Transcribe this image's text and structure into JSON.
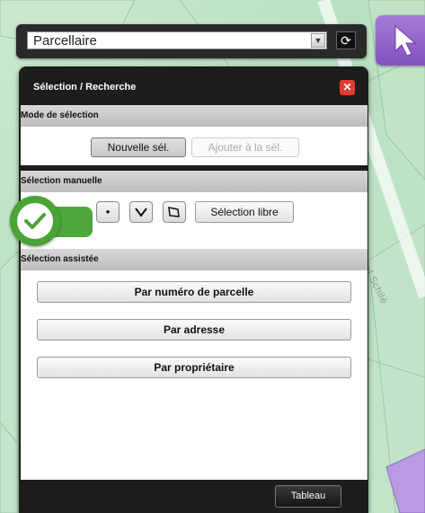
{
  "layer_select": {
    "value": "Parcellaire",
    "arrow_glyph": "▼",
    "refresh_glyph": "⟳"
  },
  "panel": {
    "title": "Sélection / Recherche",
    "close_glyph": "✕",
    "mode": {
      "header": "Mode de sélection",
      "new_selection": "Nouvelle sél.",
      "add_selection": "Ajouter à la sél."
    },
    "manual": {
      "header": "Sélection manuelle",
      "point_glyph": "•",
      "line_glyph": "∨",
      "free_selection": "Sélection libre"
    },
    "assisted": {
      "header": "Sélection assistée",
      "by_parcel_number": "Par numéro de parcelle",
      "by_address": "Par adresse",
      "by_owner": "Par propriétaire"
    },
    "footer": {
      "table_button": "Tableau"
    }
  },
  "map": {
    "street_label": "Rue Jean Michel Schilé"
  },
  "colors": {
    "accent_purple": "#8a5bc5",
    "close_red": "#e23b2f",
    "check_green": "#4aa336"
  }
}
